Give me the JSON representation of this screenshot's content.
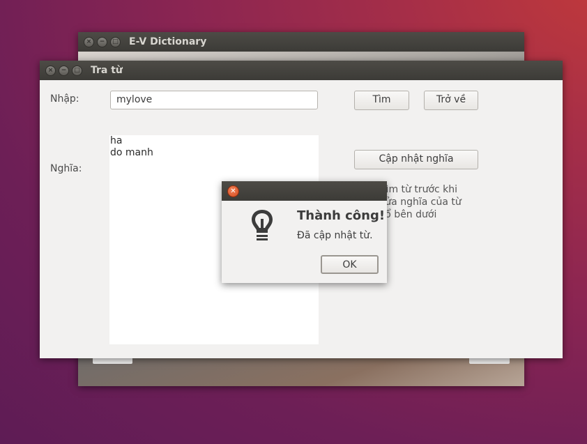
{
  "back_window": {
    "title": "E-V Dictionary"
  },
  "window": {
    "title": "Tra từ",
    "input_label": "Nhập:",
    "input_value": "mylove",
    "search_button": "Tìm",
    "back_button": "Trở về",
    "meaning_label": "Nghĩa:",
    "meaning_text": "ha\ndo manh",
    "update_button": "Cập nhật nghĩa",
    "hint_text": "Tìm từ trước khi\nsửa nghĩa của từ\nsổ bên dưới"
  },
  "dialog": {
    "title": "",
    "heading": "Thành công!",
    "message": "Đã cập nhật từ.",
    "ok_button": "OK",
    "icon": "lightbulb-icon"
  }
}
